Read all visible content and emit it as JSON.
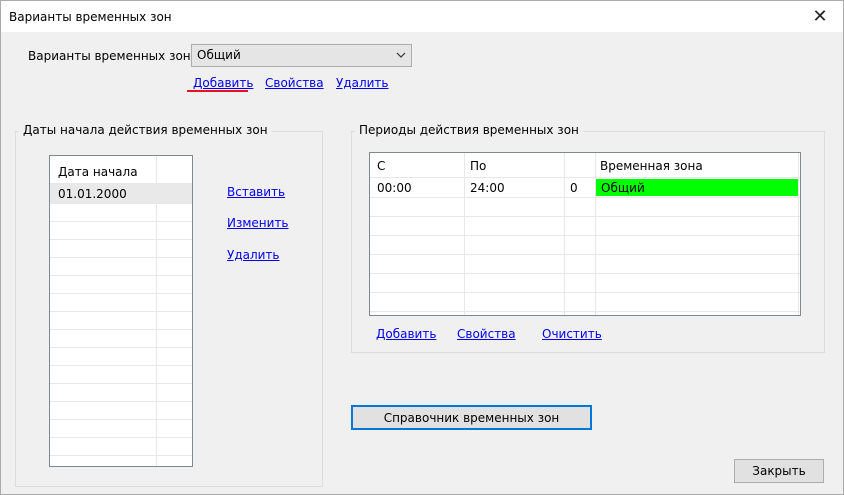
{
  "window": {
    "title": "Варианты временных зон",
    "close_glyph": "✕"
  },
  "variants": {
    "label": "Варианты временных зон:",
    "selected": "Общий",
    "links": {
      "add": "Добавить",
      "properties": "Свойства",
      "delete": "Удалить"
    }
  },
  "dates_group": {
    "title": "Даты начала действия временных зон",
    "header": "Дата начала",
    "rows": [
      "01.01.2000"
    ],
    "links": {
      "insert": "Вставить",
      "edit": "Изменить",
      "delete": "Удалить"
    }
  },
  "periods_group": {
    "title": "Периоды действия временных зон",
    "headers": {
      "from": "С",
      "to": "По",
      "num": "",
      "zone": "Временная зона"
    },
    "rows": [
      {
        "from": "00:00",
        "to": "24:00",
        "num": "0",
        "zone": "Общий",
        "zone_color": "#00ff00"
      }
    ],
    "links": {
      "add": "Добавить",
      "properties": "Свойства",
      "clear": "Очистить"
    }
  },
  "buttons": {
    "reference": "Справочник временных зон",
    "close": "Закрыть"
  },
  "colors": {
    "link": "#0000ee",
    "accent": "#0078d7",
    "underline_red": "#e81123",
    "zone_green": "#00ff00"
  }
}
